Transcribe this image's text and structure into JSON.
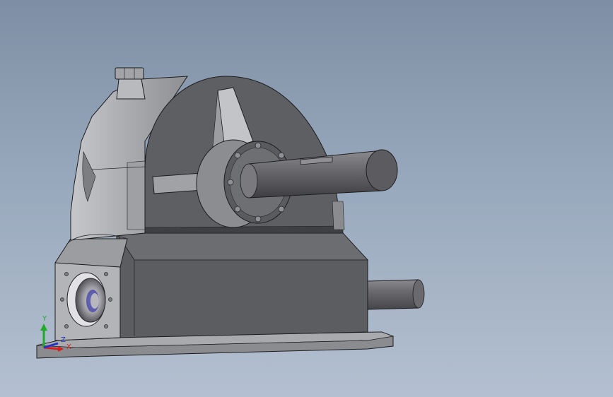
{
  "viewport": {
    "background_top": "#7e8ea4",
    "background_bottom": "#b4c0d0"
  },
  "model": {
    "body_color": "#5e5f63",
    "housing_color": "#8e8f93",
    "shaft_color": "#6a6a6d",
    "edge_color": "#1c1c1e"
  },
  "triad": {
    "x_label": "X",
    "y_label": "Y",
    "z_label": "Z",
    "x_color": "#d42020",
    "y_color": "#1faa2a",
    "z_color": "#2230c8"
  }
}
